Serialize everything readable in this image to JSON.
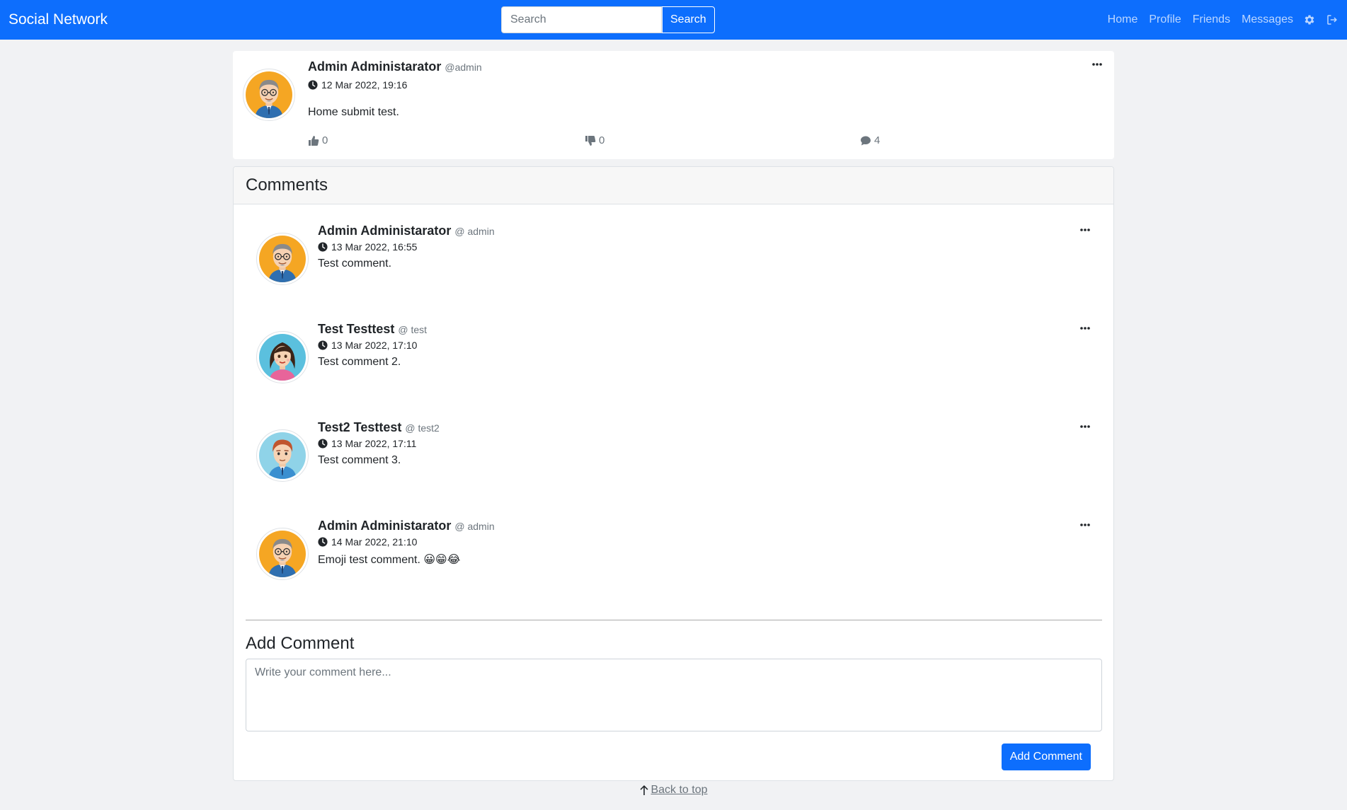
{
  "navbar": {
    "brand": "Social Network",
    "search_placeholder": "Search",
    "search_button": "Search",
    "links": [
      "Home",
      "Profile",
      "Friends",
      "Messages"
    ],
    "icons": [
      "gear-icon",
      "logout-icon"
    ]
  },
  "post": {
    "author_name": "Admin Administarator",
    "username": "@admin",
    "timestamp": "12 Mar 2022, 19:16",
    "body": "Home submit test.",
    "likes": "0",
    "dislikes": "0",
    "comments": "4"
  },
  "comments_section": {
    "title": "Comments",
    "items": [
      {
        "author_name": "Admin Administarator",
        "username": "@ admin",
        "timestamp": "13 Mar 2022, 16:55",
        "text": "Test comment.",
        "avatar": "man-glasses"
      },
      {
        "author_name": "Test Testtest",
        "username": "@ test",
        "timestamp": "13 Mar 2022, 17:10",
        "text": "Test comment 2.",
        "avatar": "woman"
      },
      {
        "author_name": "Test2 Testtest",
        "username": "@ test2",
        "timestamp": "13 Mar 2022, 17:11",
        "text": "Test comment 3.",
        "avatar": "man-red-hair"
      },
      {
        "author_name": "Admin Administarator",
        "username": "@ admin",
        "timestamp": "14 Mar 2022, 21:10",
        "text": "Emoji test comment. 😀😁😂",
        "avatar": "man-glasses"
      }
    ]
  },
  "add_comment": {
    "title": "Add Comment",
    "placeholder": "Write your comment here...",
    "button": "Add Comment"
  },
  "footer": {
    "back_to_top": " Back to top"
  },
  "colors": {
    "primary": "#0d6efd",
    "background": "#f1f2f4"
  }
}
